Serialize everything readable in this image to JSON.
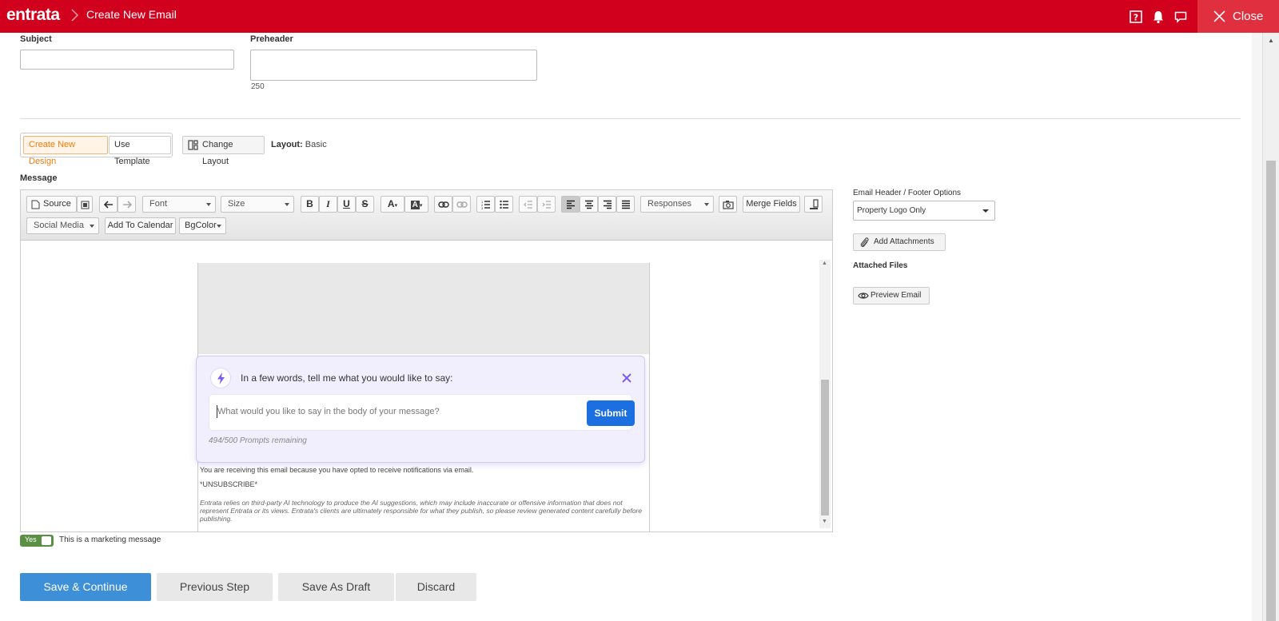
{
  "header": {
    "brand": "entrata",
    "breadcrumb": "Create New Email",
    "close_label": "Close",
    "icons": [
      "help-icon",
      "bell-icon",
      "chat-icon",
      "close-icon"
    ]
  },
  "form": {
    "subject_label": "Subject",
    "subject_value": "",
    "preheader_label": "Preheader",
    "preheader_value": "",
    "preheader_counter": "250"
  },
  "design": {
    "tabs": [
      {
        "label": "Create New Design",
        "active": true
      },
      {
        "label": "Use Template",
        "active": false
      }
    ],
    "change_layout_label": "Change Layout",
    "layout_label": "Layout:",
    "layout_value": "Basic"
  },
  "message": {
    "label": "Message",
    "toolbar": {
      "source": "Source",
      "font": "Font",
      "size": "Size",
      "responses": "Responses",
      "merge_fields": "Merge Fields",
      "social_media": "Social Media",
      "add_to_calendar": "Add To Calendar",
      "bgcolor": "BgColor"
    },
    "footer_notice": "You are receiving this email because you have opted to receive notifications via email.",
    "unsubscribe": "*UNSUBSCRIBE*",
    "ai_disclaimer": "Entrata relies on third-party AI technology to produce the AI suggestions, which may include inaccurate or offensive information that does not represent Entrata or its views. Entrata's clients are ultimately responsible for what they publish, so please review generated content carefully before publishing."
  },
  "ai_assistant": {
    "prompt": "In a few words, tell me what you would like to say:",
    "input_placeholder": "What would you like to say in the body of your message?",
    "input_value": "",
    "submit_label": "Submit",
    "remaining": "494/500 Prompts remaining",
    "accent_color": "#1c6fe0"
  },
  "marketing": {
    "toggle_label": "Yes",
    "toggle_on": true,
    "text": "This is a marketing message"
  },
  "sidebar": {
    "header_footer_label": "Email Header / Footer Options",
    "header_footer_value": "Property Logo Only",
    "add_attachments_label": "Add Attachments",
    "attached_files_label": "Attached Files",
    "preview_label": "Preview Email"
  },
  "actions": {
    "save_continue": "Save & Continue",
    "previous_step": "Previous Step",
    "save_draft": "Save As Draft",
    "discard": "Discard"
  },
  "colors": {
    "brand_red": "#d1001c",
    "primary_blue": "#3d8fd8",
    "active_tab_orange": "#f27b0f",
    "toggle_green": "#5a8f44"
  }
}
